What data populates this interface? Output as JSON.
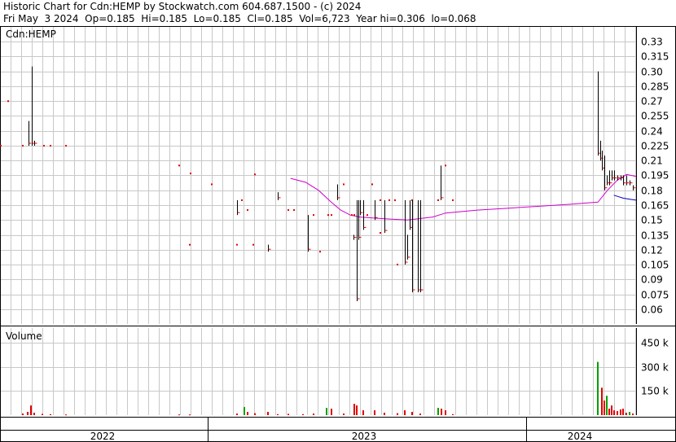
{
  "header": {
    "title": "Historic Chart for Cdn:HEMP by Stockwatch.com 604.687.1500 - (c) 2024",
    "stats": "Fri May  3 2024  Op=0.185  Hi=0.185  Lo=0.185  Cl=0.185  Vol=6,723  Year hi=0.306  lo=0.068"
  },
  "colors": {
    "grid": "#c8c8c8",
    "price_up": "#000000",
    "price_dot": "#e00000",
    "ma_long": "#d000d0",
    "ma_short": "#0000c0",
    "vol_up": "#00a000",
    "vol_down": "#e00000"
  },
  "chart_data": [
    {
      "type": "line",
      "title": "Cdn:HEMP",
      "ylim": [
        0.045,
        0.345
      ],
      "yticks": [
        "0.33",
        "0.315",
        "0.30",
        "0.285",
        "0.27",
        "0.255",
        "0.24",
        "0.225",
        "0.21",
        "0.195",
        "0.18",
        "0.165",
        "0.15",
        "0.135",
        "0.12",
        "0.105",
        "0.09",
        "0.075",
        "0.06"
      ],
      "x_axis_labels": [
        "2022",
        "2023",
        "2024"
      ],
      "price_bars": [
        {
          "x": 0.0,
          "hi": 0.225,
          "lo": 0.225
        },
        {
          "x": 0.012,
          "hi": 0.27,
          "lo": 0.27
        },
        {
          "x": 0.035,
          "hi": 0.225,
          "lo": 0.225
        },
        {
          "x": 0.044,
          "hi": 0.25,
          "lo": 0.225
        },
        {
          "x": 0.049,
          "hi": 0.305,
          "lo": 0.225
        },
        {
          "x": 0.052,
          "hi": 0.23,
          "lo": 0.225
        },
        {
          "x": 0.068,
          "hi": 0.225,
          "lo": 0.225
        },
        {
          "x": 0.078,
          "hi": 0.225,
          "lo": 0.225
        },
        {
          "x": 0.102,
          "hi": 0.225,
          "lo": 0.225
        },
        {
          "x": 0.281,
          "hi": 0.205,
          "lo": 0.205
        },
        {
          "x": 0.299,
          "hi": 0.197,
          "lo": 0.197
        },
        {
          "x": 0.332,
          "hi": 0.186,
          "lo": 0.186
        },
        {
          "x": 0.297,
          "hi": 0.125,
          "lo": 0.125
        },
        {
          "x": 0.372,
          "hi": 0.17,
          "lo": 0.155
        },
        {
          "x": 0.38,
          "hi": 0.17,
          "lo": 0.17
        },
        {
          "x": 0.388,
          "hi": 0.16,
          "lo": 0.16
        },
        {
          "x": 0.4,
          "hi": 0.196,
          "lo": 0.196
        },
        {
          "x": 0.372,
          "hi": 0.125,
          "lo": 0.125
        },
        {
          "x": 0.398,
          "hi": 0.125,
          "lo": 0.125
        },
        {
          "x": 0.42,
          "hi": 0.125,
          "lo": 0.118
        },
        {
          "x": 0.436,
          "hi": 0.178,
          "lo": 0.17
        },
        {
          "x": 0.452,
          "hi": 0.16,
          "lo": 0.16
        },
        {
          "x": 0.462,
          "hi": 0.16,
          "lo": 0.16
        },
        {
          "x": 0.483,
          "hi": 0.155,
          "lo": 0.118
        },
        {
          "x": 0.492,
          "hi": 0.155,
          "lo": 0.155
        },
        {
          "x": 0.503,
          "hi": 0.118,
          "lo": 0.118
        },
        {
          "x": 0.515,
          "hi": 0.155,
          "lo": 0.155
        },
        {
          "x": 0.52,
          "hi": 0.155,
          "lo": 0.155
        },
        {
          "x": 0.53,
          "hi": 0.186,
          "lo": 0.17
        },
        {
          "x": 0.54,
          "hi": 0.186,
          "lo": 0.186
        },
        {
          "x": 0.552,
          "hi": 0.155,
          "lo": 0.155
        },
        {
          "x": 0.556,
          "hi": 0.155,
          "lo": 0.155
        },
        {
          "x": 0.565,
          "hi": 0.17,
          "lo": 0.155
        },
        {
          "x": 0.577,
          "hi": 0.155,
          "lo": 0.155
        },
        {
          "x": 0.585,
          "hi": 0.186,
          "lo": 0.186
        },
        {
          "x": 0.597,
          "hi": 0.17,
          "lo": 0.17
        },
        {
          "x": 0.598,
          "hi": 0.137,
          "lo": 0.137
        },
        {
          "x": 0.611,
          "hi": 0.17,
          "lo": 0.17
        },
        {
          "x": 0.621,
          "hi": 0.17,
          "lo": 0.17
        },
        {
          "x": 0.648,
          "hi": 0.17,
          "lo": 0.17
        },
        {
          "x": 0.555,
          "hi": 0.135,
          "lo": 0.13
        },
        {
          "x": 0.56,
          "hi": 0.17,
          "lo": 0.068
        },
        {
          "x": 0.563,
          "hi": 0.17,
          "lo": 0.13
        },
        {
          "x": 0.571,
          "hi": 0.17,
          "lo": 0.14
        },
        {
          "x": 0.588,
          "hi": 0.17,
          "lo": 0.15
        },
        {
          "x": 0.604,
          "hi": 0.17,
          "lo": 0.137
        },
        {
          "x": 0.624,
          "hi": 0.105,
          "lo": 0.105
        },
        {
          "x": 0.636,
          "hi": 0.17,
          "lo": 0.105
        },
        {
          "x": 0.64,
          "hi": 0.135,
          "lo": 0.11
        },
        {
          "x": 0.644,
          "hi": 0.17,
          "lo": 0.14
        },
        {
          "x": 0.648,
          "hi": 0.17,
          "lo": 0.077
        },
        {
          "x": 0.656,
          "hi": 0.17,
          "lo": 0.077
        },
        {
          "x": 0.66,
          "hi": 0.17,
          "lo": 0.077
        },
        {
          "x": 0.688,
          "hi": 0.17,
          "lo": 0.17
        },
        {
          "x": 0.692,
          "hi": 0.205,
          "lo": 0.17
        },
        {
          "x": 0.7,
          "hi": 0.205,
          "lo": 0.205
        },
        {
          "x": 0.712,
          "hi": 0.17,
          "lo": 0.17
        },
        {
          "x": 0.94,
          "hi": 0.3,
          "lo": 0.215
        },
        {
          "x": 0.943,
          "hi": 0.23,
          "lo": 0.21
        },
        {
          "x": 0.946,
          "hi": 0.22,
          "lo": 0.2
        },
        {
          "x": 0.95,
          "hi": 0.215,
          "lo": 0.18
        },
        {
          "x": 0.954,
          "hi": 0.195,
          "lo": 0.185
        },
        {
          "x": 0.958,
          "hi": 0.2,
          "lo": 0.185
        },
        {
          "x": 0.962,
          "hi": 0.2,
          "lo": 0.19
        },
        {
          "x": 0.966,
          "hi": 0.2,
          "lo": 0.19
        },
        {
          "x": 0.97,
          "hi": 0.195,
          "lo": 0.19
        },
        {
          "x": 0.975,
          "hi": 0.195,
          "lo": 0.19
        },
        {
          "x": 0.98,
          "hi": 0.195,
          "lo": 0.185
        },
        {
          "x": 0.985,
          "hi": 0.195,
          "lo": 0.185
        },
        {
          "x": 0.99,
          "hi": 0.19,
          "lo": 0.185
        },
        {
          "x": 0.995,
          "hi": 0.185,
          "lo": 0.18
        }
      ],
      "series": [
        {
          "points": [
            [
              0.456,
              0.192
            ],
            [
              0.48,
              0.188
            ],
            [
              0.5,
              0.18
            ],
            [
              0.52,
              0.168
            ],
            [
              0.535,
              0.16
            ],
            [
              0.55,
              0.155
            ],
            [
              0.565,
              0.153
            ],
            [
              0.585,
              0.152
            ],
            [
              0.61,
              0.151
            ],
            [
              0.64,
              0.15
            ],
            [
              0.68,
              0.153
            ],
            [
              0.7,
              0.157
            ],
            [
              0.75,
              0.16
            ],
            [
              0.8,
              0.162
            ],
            [
              0.85,
              0.164
            ],
            [
              0.9,
              0.166
            ],
            [
              0.94,
              0.168
            ],
            [
              0.955,
              0.18
            ],
            [
              0.97,
              0.19
            ],
            [
              0.985,
              0.196
            ],
            [
              1.0,
              0.194
            ]
          ]
        },
        {
          "points": [
            [
              0.965,
              0.175
            ],
            [
              0.98,
              0.172
            ],
            [
              0.99,
              0.171
            ],
            [
              1.0,
              0.17
            ]
          ]
        }
      ]
    },
    {
      "type": "bar",
      "title": "Volume",
      "yticks": [
        "450 k",
        "300 k",
        "150 k"
      ],
      "ylim": [
        0,
        540
      ],
      "bars": [
        {
          "x": 0.035,
          "v": 10,
          "up": false
        },
        {
          "x": 0.042,
          "v": 20,
          "up": false
        },
        {
          "x": 0.047,
          "v": 60,
          "up": false
        },
        {
          "x": 0.052,
          "v": 15,
          "up": false
        },
        {
          "x": 0.066,
          "v": 8,
          "up": false
        },
        {
          "x": 0.078,
          "v": 6,
          "up": false
        },
        {
          "x": 0.102,
          "v": 4,
          "up": false
        },
        {
          "x": 0.281,
          "v": 4,
          "up": false
        },
        {
          "x": 0.297,
          "v": 4,
          "up": false
        },
        {
          "x": 0.372,
          "v": 10,
          "up": false
        },
        {
          "x": 0.383,
          "v": 50,
          "up": true
        },
        {
          "x": 0.388,
          "v": 20,
          "up": false
        },
        {
          "x": 0.4,
          "v": 12,
          "up": false
        },
        {
          "x": 0.42,
          "v": 20,
          "up": false
        },
        {
          "x": 0.436,
          "v": 6,
          "up": false
        },
        {
          "x": 0.452,
          "v": 8,
          "up": false
        },
        {
          "x": 0.476,
          "v": 6,
          "up": false
        },
        {
          "x": 0.492,
          "v": 10,
          "up": false
        },
        {
          "x": 0.513,
          "v": 45,
          "up": true
        },
        {
          "x": 0.52,
          "v": 40,
          "up": false
        },
        {
          "x": 0.54,
          "v": 10,
          "up": false
        },
        {
          "x": 0.556,
          "v": 70,
          "up": false
        },
        {
          "x": 0.56,
          "v": 60,
          "up": false
        },
        {
          "x": 0.571,
          "v": 30,
          "up": false
        },
        {
          "x": 0.588,
          "v": 30,
          "up": false
        },
        {
          "x": 0.604,
          "v": 15,
          "up": false
        },
        {
          "x": 0.624,
          "v": 12,
          "up": false
        },
        {
          "x": 0.636,
          "v": 30,
          "up": false
        },
        {
          "x": 0.648,
          "v": 20,
          "up": false
        },
        {
          "x": 0.66,
          "v": 10,
          "up": false
        },
        {
          "x": 0.688,
          "v": 45,
          "up": true
        },
        {
          "x": 0.694,
          "v": 40,
          "up": false
        },
        {
          "x": 0.7,
          "v": 30,
          "up": false
        },
        {
          "x": 0.712,
          "v": 6,
          "up": false
        },
        {
          "x": 0.94,
          "v": 330,
          "up": true
        },
        {
          "x": 0.946,
          "v": 170,
          "up": false
        },
        {
          "x": 0.95,
          "v": 90,
          "up": false
        },
        {
          "x": 0.954,
          "v": 120,
          "up": true
        },
        {
          "x": 0.958,
          "v": 40,
          "up": false
        },
        {
          "x": 0.962,
          "v": 60,
          "up": false
        },
        {
          "x": 0.966,
          "v": 30,
          "up": false
        },
        {
          "x": 0.97,
          "v": 25,
          "up": false
        },
        {
          "x": 0.975,
          "v": 35,
          "up": false
        },
        {
          "x": 0.98,
          "v": 40,
          "up": false
        },
        {
          "x": 0.985,
          "v": 15,
          "up": false
        },
        {
          "x": 0.99,
          "v": 20,
          "up": true
        },
        {
          "x": 0.995,
          "v": 10,
          "up": false
        }
      ]
    }
  ]
}
